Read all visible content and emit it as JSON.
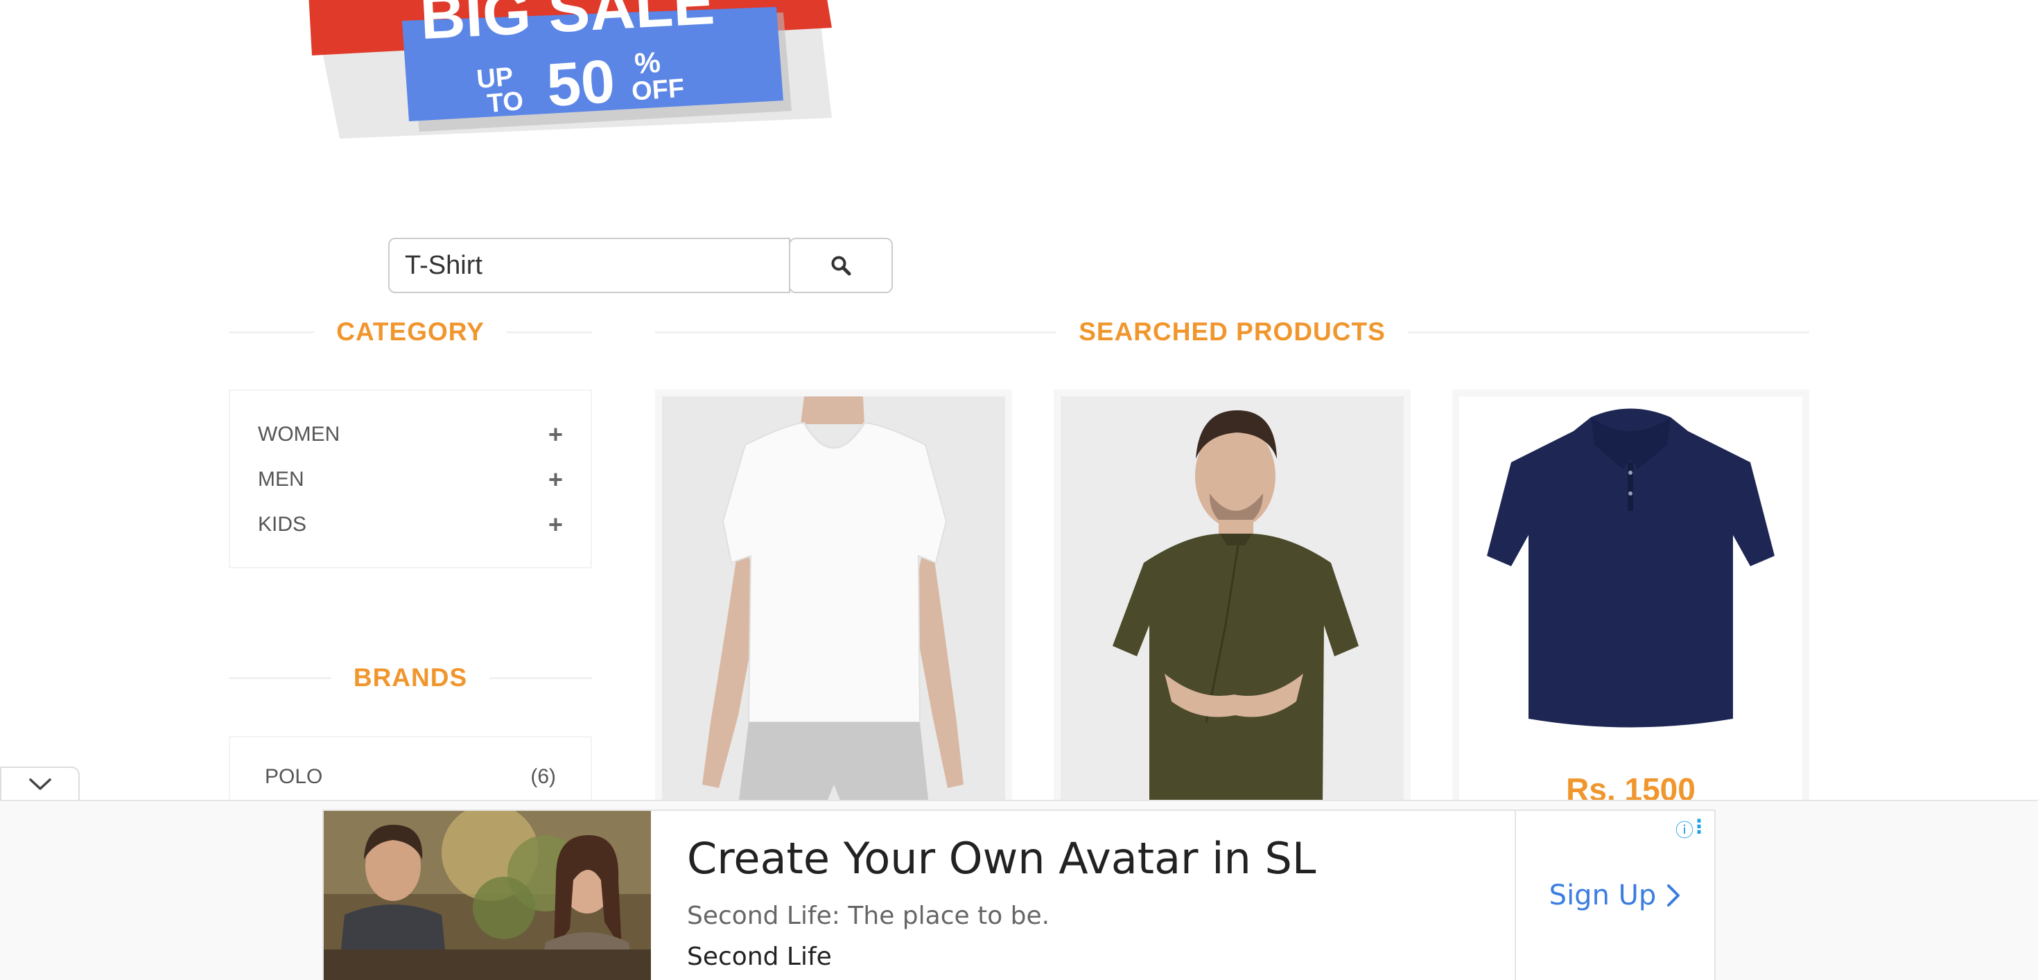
{
  "banner": {
    "line1": "BIG SALE",
    "up_to": "UP TO",
    "discount": "50",
    "percent": "%",
    "off": "OFF"
  },
  "search": {
    "value": "T-Shirt",
    "button_icon": "search-icon"
  },
  "category": {
    "heading": "CATEGORY",
    "items": [
      {
        "label": "WOMEN",
        "icon": "plus-icon"
      },
      {
        "label": "MEN",
        "icon": "plus-icon"
      },
      {
        "label": "KIDS",
        "icon": "plus-icon"
      }
    ]
  },
  "brands": {
    "heading": "BRANDS",
    "items": [
      {
        "label": "POLO",
        "count": "(6)"
      }
    ]
  },
  "products": {
    "heading": "SEARCHED PRODUCTS",
    "items": [
      {
        "image": "white-vneck-tshirt-model"
      },
      {
        "image": "olive-henley-shirt-model"
      },
      {
        "image": "navy-polo-shirt",
        "price": "Rs. 1500"
      }
    ]
  },
  "ad": {
    "title": "Create Your Own Avatar in SL",
    "subtitle": "Second Life: The place to be.",
    "advertiser": "Second Life",
    "cta": "Sign Up",
    "info_icon": "info-icon",
    "menu_icon": "more-vert-icon"
  },
  "colors": {
    "accent": "#f0962d",
    "cta_blue": "#3b7de0"
  }
}
